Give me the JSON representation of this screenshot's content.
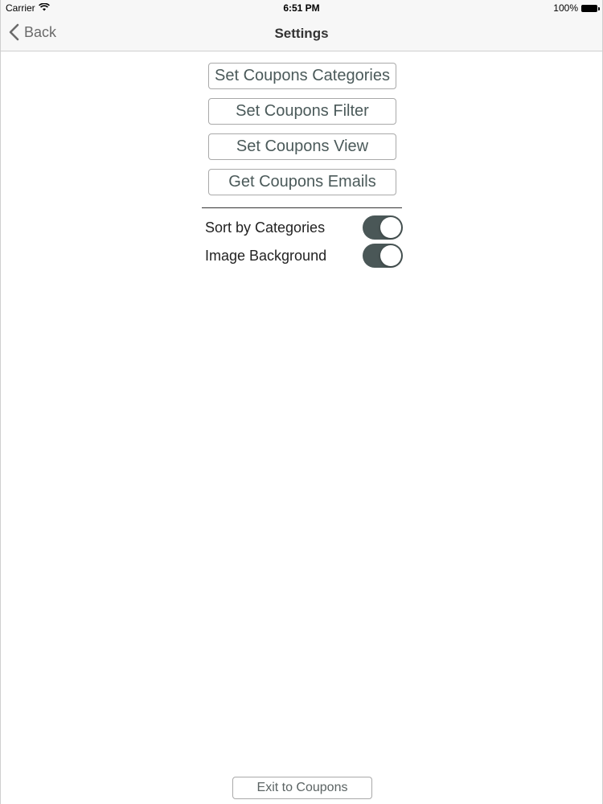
{
  "status_bar": {
    "carrier": "Carrier",
    "time": "6:51 PM",
    "battery": "100%"
  },
  "nav": {
    "back_label": "Back",
    "title": "Settings"
  },
  "buttons": [
    {
      "label": "Set Coupons Categories"
    },
    {
      "label": "Set Coupons Filter"
    },
    {
      "label": "Set Coupons View"
    },
    {
      "label": "Get Coupons Emails"
    }
  ],
  "toggles": [
    {
      "label": "Sort by Categories",
      "on": true
    },
    {
      "label": "Image Background",
      "on": true
    }
  ],
  "footer": {
    "exit_label": "Exit to Coupons"
  },
  "colors": {
    "toggle_on": "#4a5757",
    "button_text": "#4b5a5a"
  },
  "icons": {
    "wifi": "wifi-icon",
    "battery": "battery-icon",
    "back": "chevron-left-icon"
  }
}
